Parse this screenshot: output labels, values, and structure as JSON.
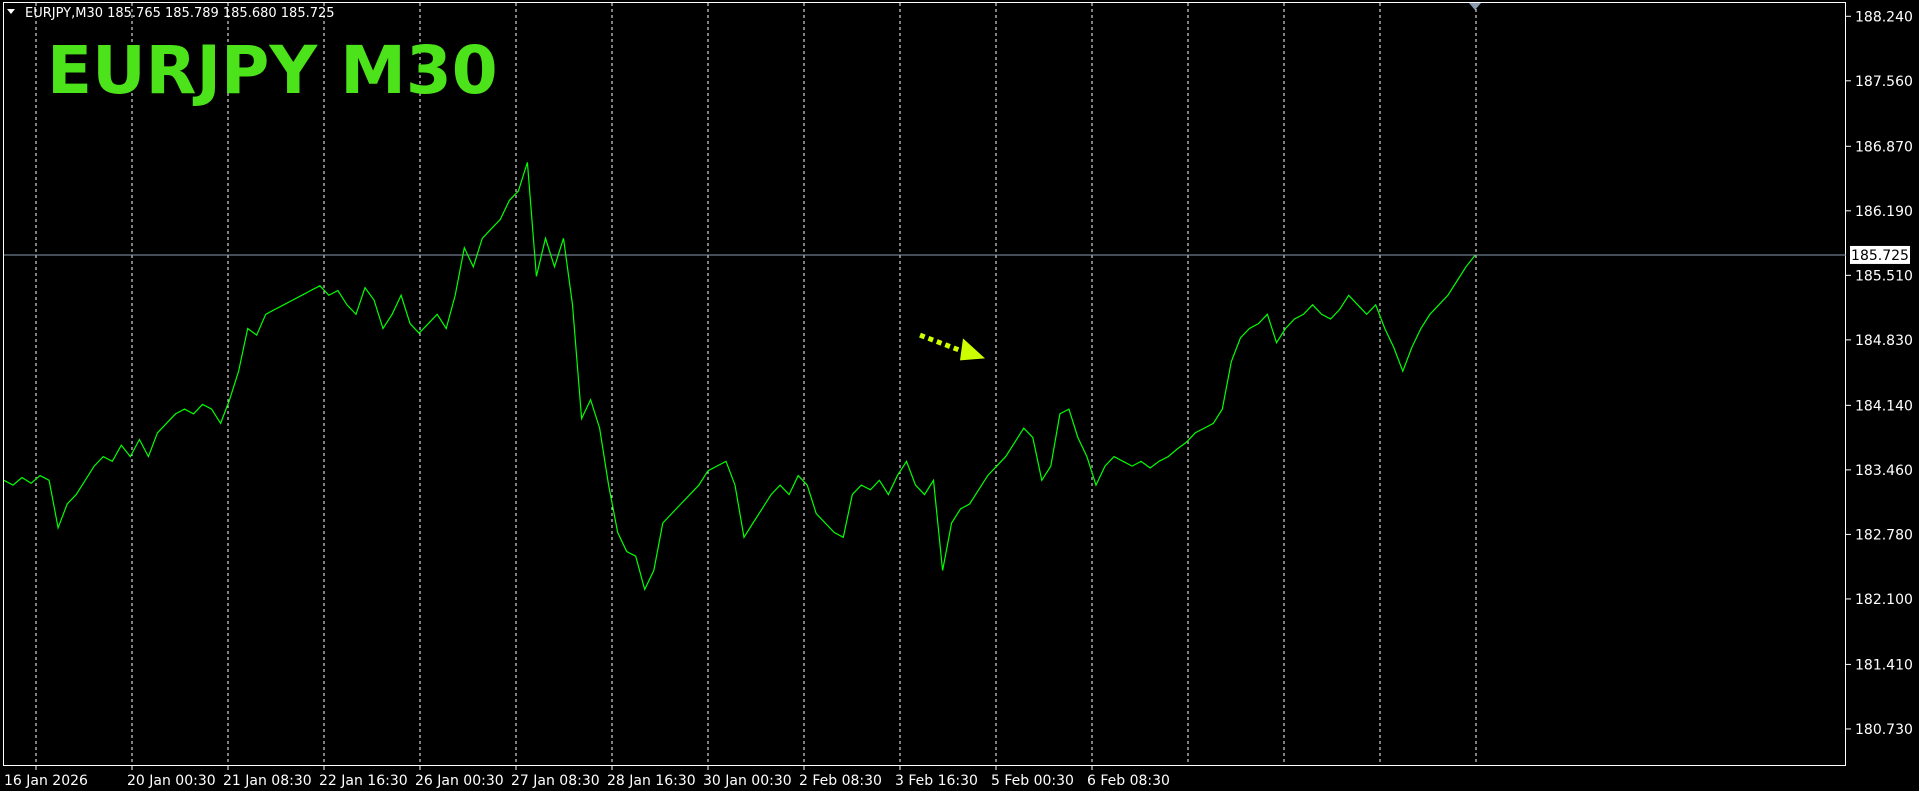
{
  "header": {
    "symbol_info": "EURJPY,M30  185.765 185.789 185.680 185.725",
    "overlay_label": "EURJPY  M30"
  },
  "colors": {
    "background": "#000000",
    "line": "#00ff00",
    "overlay_label": "#4de31b",
    "arrow": "#ccff00",
    "grid": "#ffffff",
    "price_line": "#8a9bb0"
  },
  "chart_data": {
    "type": "line",
    "title": "",
    "xlabel": "",
    "ylabel": "",
    "ylim": [
      180.35,
      188.38
    ],
    "yticks": [
      "188.240",
      "187.560",
      "186.870",
      "186.190",
      "185.510",
      "184.830",
      "184.140",
      "183.460",
      "182.780",
      "182.100",
      "181.410",
      "180.730"
    ],
    "xticks": [
      "16 Jan 2026",
      "20 Jan 00:30",
      "21 Jan 08:30",
      "22 Jan 16:30",
      "26 Jan 00:30",
      "27 Jan 08:30",
      "28 Jan 16:30",
      "30 Jan 00:30",
      "2 Feb 08:30",
      "3 Feb 16:30",
      "5 Feb 00:30",
      "6 Feb 08:30"
    ],
    "grid": "vertical dotted",
    "current_price": 185.725,
    "current_price_label": "185.725",
    "series": [
      {
        "values": [
          183.35,
          183.3,
          183.38,
          183.32,
          183.4,
          183.35,
          182.85,
          183.1,
          183.2,
          183.35,
          183.5,
          183.6,
          183.55,
          183.72,
          183.6,
          183.78,
          183.6,
          183.85,
          183.95,
          184.05,
          184.1,
          184.05,
          184.15,
          184.1,
          183.95,
          184.2,
          184.5,
          184.95,
          184.88,
          185.1,
          185.15,
          185.2,
          185.25,
          185.3,
          185.35,
          185.4,
          185.3,
          185.35,
          185.2,
          185.1,
          185.38,
          185.25,
          184.95,
          185.1,
          185.3,
          185.0,
          184.9,
          185.0,
          185.1,
          184.95,
          185.3,
          185.8,
          185.6,
          185.9,
          186.0,
          186.1,
          186.3,
          186.4,
          186.7,
          185.5,
          185.9,
          185.6,
          185.9,
          185.2,
          184.0,
          184.2,
          183.9,
          183.3,
          182.8,
          182.6,
          182.55,
          182.2,
          182.4,
          182.9,
          183.0,
          183.1,
          183.2,
          183.3,
          183.45,
          183.5,
          183.55,
          183.3,
          182.75,
          182.9,
          183.05,
          183.2,
          183.3,
          183.2,
          183.4,
          183.3,
          183.0,
          182.9,
          182.8,
          182.75,
          183.2,
          183.3,
          183.25,
          183.35,
          183.2,
          183.4,
          183.55,
          183.3,
          183.2,
          183.35,
          182.4,
          182.9,
          183.05,
          183.1,
          183.25,
          183.4,
          183.5,
          183.6,
          183.75,
          183.9,
          183.8,
          183.35,
          183.5,
          184.05,
          184.1,
          183.8,
          183.6,
          183.3,
          183.5,
          183.6,
          183.55,
          183.5,
          183.55,
          183.48,
          183.55,
          183.6,
          183.68,
          183.75,
          183.85,
          183.9,
          183.95,
          184.1,
          184.6,
          184.85,
          184.95,
          185.0,
          185.1,
          184.8,
          184.95,
          185.05,
          185.1,
          185.2,
          185.1,
          185.05,
          185.15,
          185.3,
          185.2,
          185.1,
          185.2,
          184.95,
          184.75,
          184.5,
          184.75,
          184.95,
          185.1,
          185.2,
          185.3,
          185.45,
          185.6,
          185.72
        ],
        "x_start": "16 Jan 2026",
        "x_end": "6 Feb 08:30"
      }
    ],
    "annotations": [
      {
        "type": "arrow",
        "from": [
          "30 Jan 00:30",
          184.88
        ],
        "to": [
          "2 Feb 08:30",
          184.72
        ]
      }
    ]
  }
}
